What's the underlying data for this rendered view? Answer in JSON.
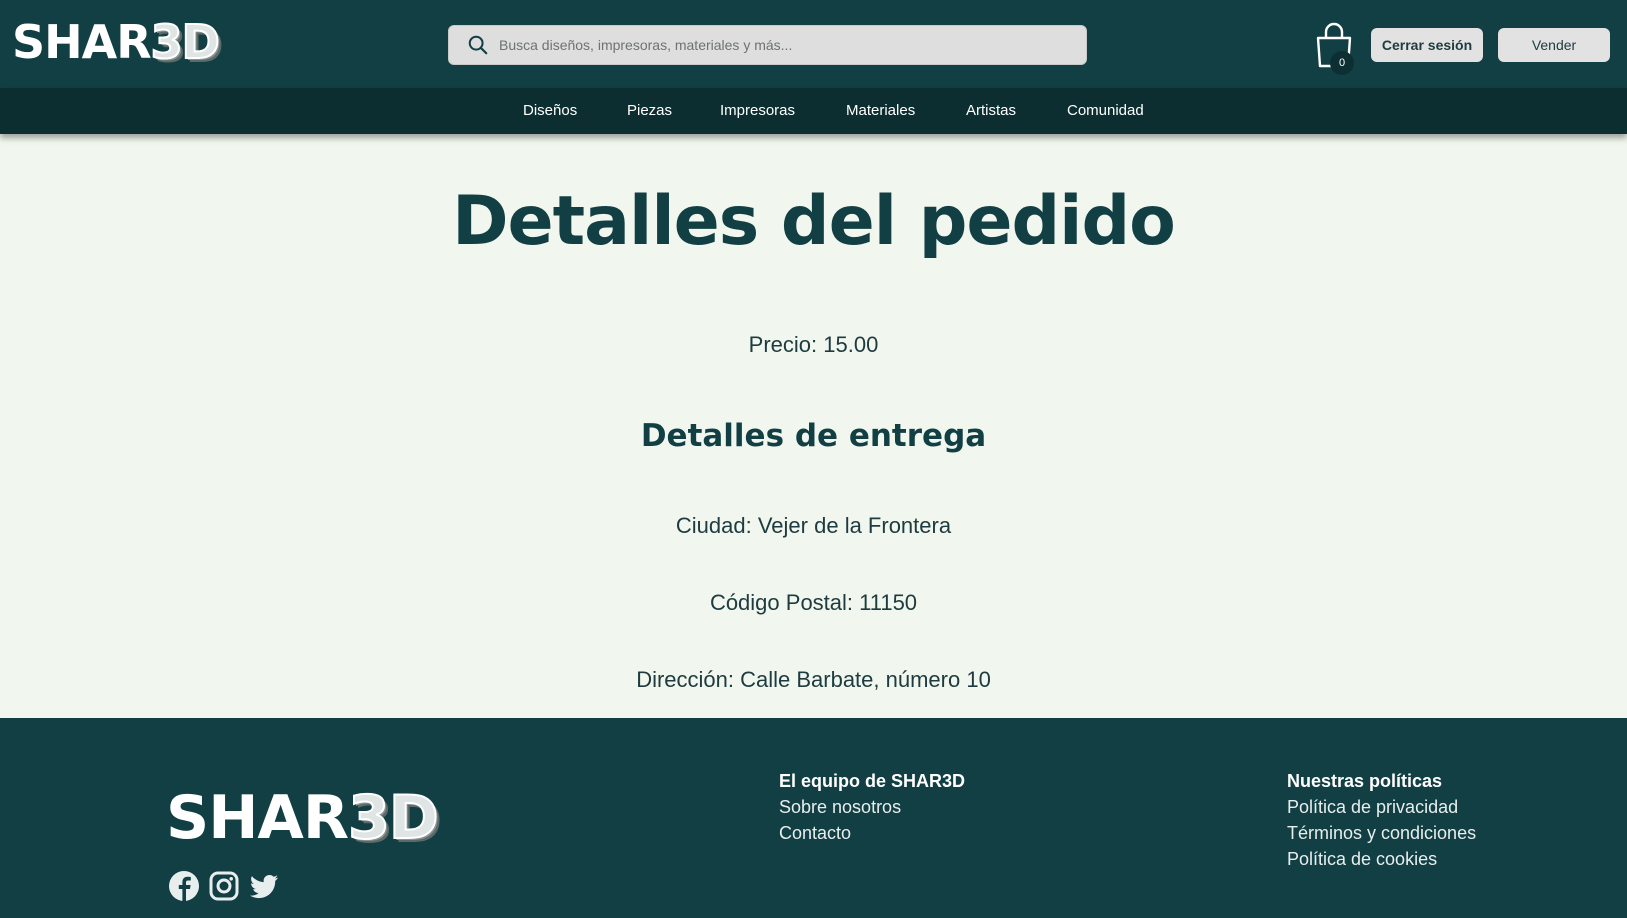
{
  "header": {
    "logo": {
      "shar": "SHAR",
      "three": "3",
      "d": "D"
    },
    "search": {
      "placeholder": "Busca diseños, impresoras, materiales y más...",
      "icon": "search-icon"
    },
    "cart": {
      "icon": "shopping-bag-icon",
      "count": "0"
    },
    "logout_label": "Cerrar sesión",
    "sell_label": "Vender"
  },
  "nav": {
    "items": [
      {
        "label": "Diseños"
      },
      {
        "label": "Piezas"
      },
      {
        "label": "Impresoras"
      },
      {
        "label": "Materiales"
      },
      {
        "label": "Artistas"
      },
      {
        "label": "Comunidad"
      }
    ]
  },
  "main": {
    "title": "Detalles del pedido",
    "price": "Precio: 15.00",
    "delivery_title": "Detalles de entrega",
    "city": "Ciudad: Vejer de la Frontera",
    "postal_code": "Código Postal: 11150",
    "address": "Dirección: Calle Barbate, número 10"
  },
  "footer": {
    "logo": {
      "shar": "SHAR",
      "three": "3",
      "d": "D"
    },
    "social": [
      "facebook-icon",
      "instagram-icon",
      "twitter-icon"
    ],
    "team": {
      "heading": "El equipo de SHAR3D",
      "links": [
        "Sobre nosotros",
        "Contacto"
      ]
    },
    "policies": {
      "heading": "Nuestras políticas",
      "links": [
        "Política de privacidad",
        "Términos y condiciones",
        "Política de cookies"
      ]
    }
  },
  "colors": {
    "header_bg": "#123f44",
    "nav_bg": "#0c2e30",
    "page_bg": "#f1f6ee",
    "button_bg": "#e2e2e2"
  }
}
